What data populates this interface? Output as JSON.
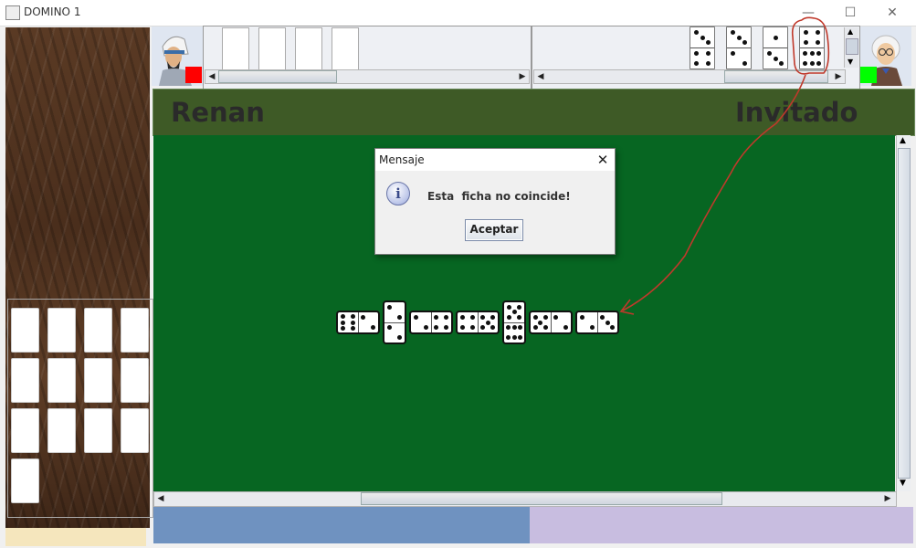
{
  "window": {
    "title": "DOMINO 1",
    "minimize": "—",
    "maximize": "☐",
    "close": "✕"
  },
  "players": {
    "left": "Renan",
    "right": "Invitado"
  },
  "dialog": {
    "title": "Mensaje",
    "message": "Esta  ficha no coincide!",
    "ok_label": "Aceptar",
    "close_label": "✕",
    "info_glyph": "i"
  },
  "board": {
    "chain": [
      {
        "orientation": "h",
        "a": 6,
        "b": 2
      },
      {
        "orientation": "v",
        "a": 2,
        "b": 2
      },
      {
        "orientation": "h",
        "a": 2,
        "b": 4
      },
      {
        "orientation": "h",
        "a": 4,
        "b": 5
      },
      {
        "orientation": "v",
        "a": 5,
        "b": 6
      },
      {
        "orientation": "h",
        "a": 5,
        "b": 2
      },
      {
        "orientation": "h",
        "a": 2,
        "b": 3
      }
    ]
  },
  "opponent_hand": {
    "tiles": [
      {
        "a": 3,
        "b": 4
      },
      {
        "a": 3,
        "b": 2
      },
      {
        "a": 1,
        "b": 3
      },
      {
        "a": 4,
        "b": 6
      }
    ],
    "highlighted_index": 3
  },
  "player_hand": {
    "hidden_count": 4
  },
  "stock": {
    "count": 13
  },
  "colors": {
    "player_indicator": "#ff0000",
    "opponent_indicator": "#00ff00",
    "board": "#076622",
    "annotation": "#c0392b"
  }
}
